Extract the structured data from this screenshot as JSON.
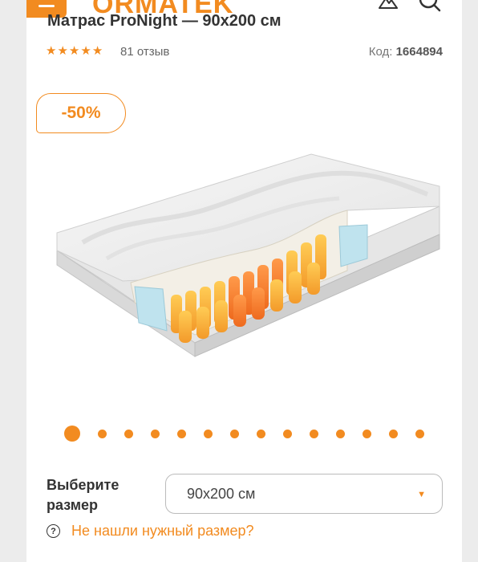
{
  "header": {
    "logo": "ORMATEK",
    "menu_icon": "hamburger-icon",
    "icons": [
      "mountain-icon",
      "search-icon"
    ]
  },
  "product": {
    "title": "Матрас ProNight — 90x200 см",
    "rating": 5,
    "reviews": "81 отзыв",
    "code_label": "Код:",
    "code_value": "1664894",
    "discount": "-50%",
    "image": "mattress-cutaway-image"
  },
  "gallery": {
    "total_slides": 14,
    "active_index": 0
  },
  "size": {
    "label": "Выберите размер",
    "selected": "90x200 см",
    "help_text": "Не нашли нужный размер?"
  },
  "colors": {
    "accent": "#f28b20",
    "text": "#333333",
    "background": "#ececec"
  }
}
